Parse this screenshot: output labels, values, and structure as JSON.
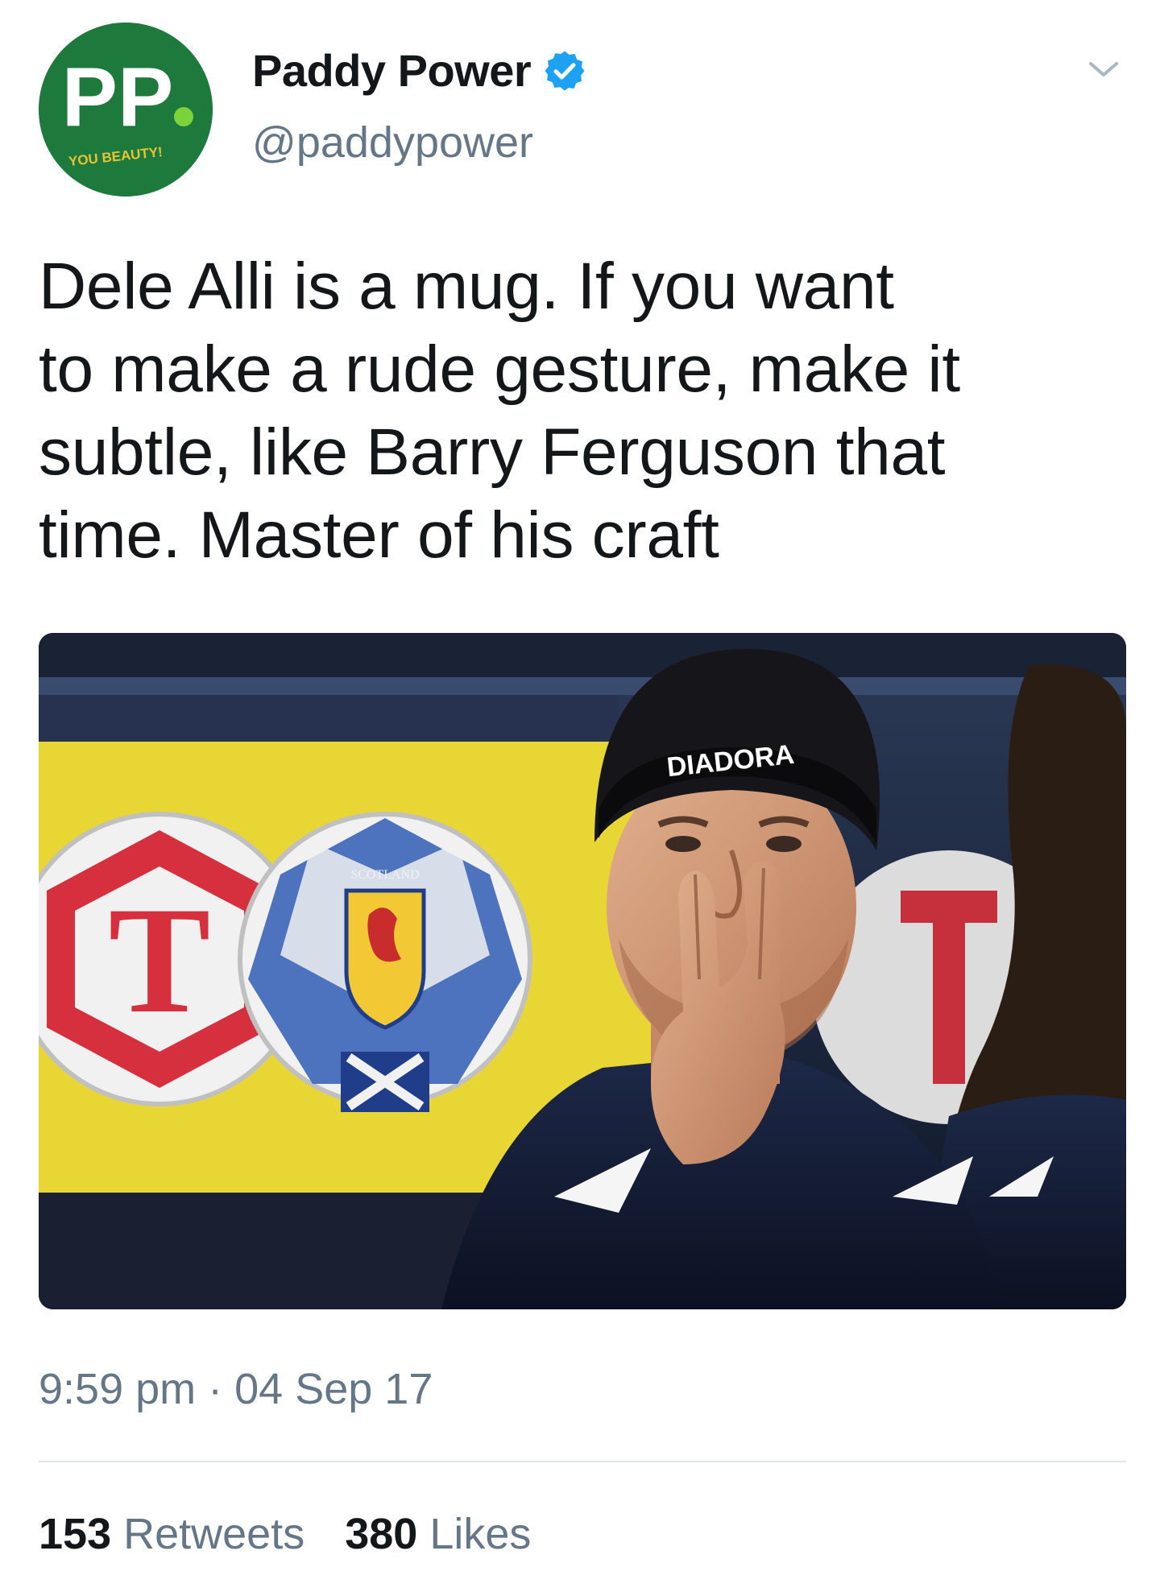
{
  "account": {
    "display_name": "Paddy Power",
    "handle": "@paddypower",
    "verified": true,
    "avatar": {
      "logo_text": "PP",
      "slogan": "YOU BEAUTY!",
      "brand_color": "#1e7a3c"
    }
  },
  "tweet": {
    "lines": [
      "Dele Alli is a mug. If you want",
      "to make a rude gesture, make it",
      "subtle, like Barry Ferguson that",
      "time. Master of his craft"
    ],
    "image": {
      "hat_brand": "DIADORA",
      "crest_text": "SCOTLAND",
      "sponsor_letter": "T"
    },
    "time": "9:59 pm",
    "separator": "·",
    "date": "04 Sep 17"
  },
  "stats": {
    "retweets": {
      "count": "153",
      "label": "Retweets"
    },
    "likes": {
      "count": "380",
      "label": "Likes"
    }
  },
  "colors": {
    "text": "#14171a",
    "secondary": "#657786",
    "verified": "#1da1f2",
    "divider": "#e1e8ed"
  },
  "icons": [
    "verified-badge-icon",
    "chevron-down-icon"
  ]
}
